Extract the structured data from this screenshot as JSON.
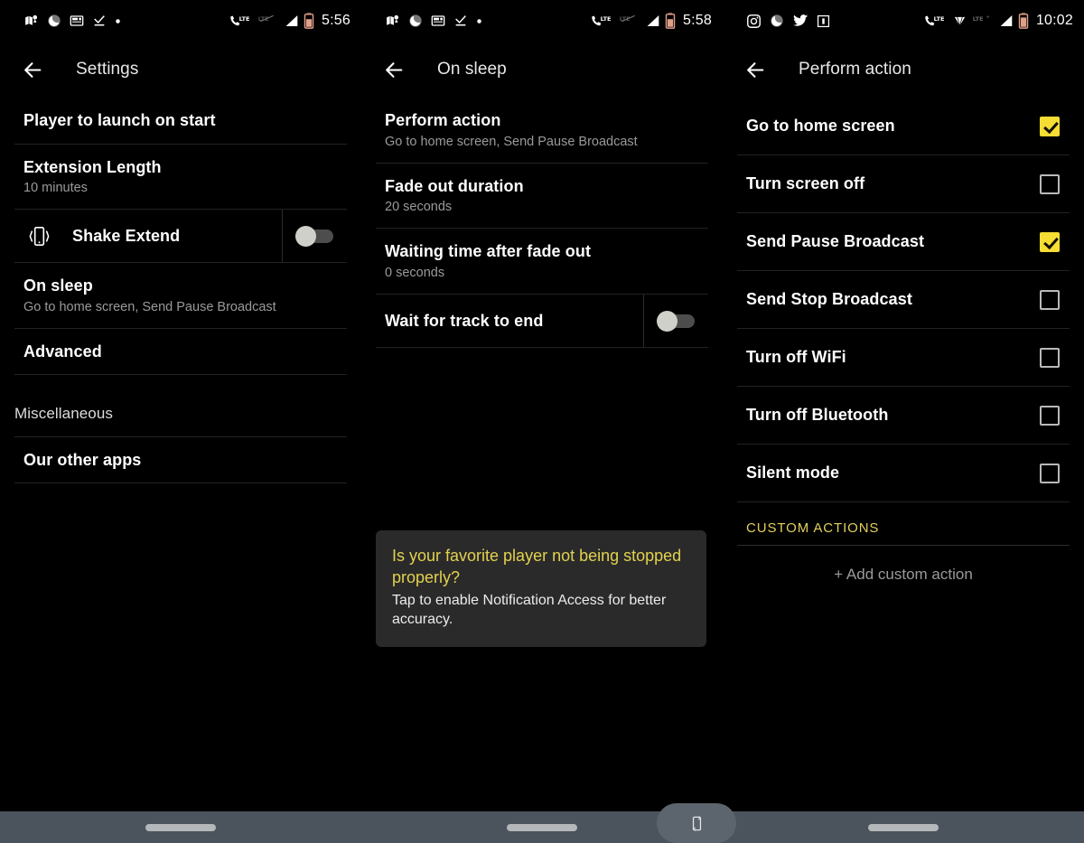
{
  "theme": {
    "background": "#000000",
    "accent_yellow": "#f5dd34",
    "snackbar_bg": "#2a2a2a",
    "navbar_bg": "#4b545c",
    "divider": "#222222"
  },
  "screens": [
    {
      "id": "settings",
      "statusbar": {
        "left_icons": [
          "map-location-icon",
          "do-not-disturb-moon-icon",
          "news-card-icon",
          "check-download-icon",
          "dot-icon"
        ],
        "right_icons": [
          "phone-lte-icon",
          "lte-secondary-icon",
          "signal-bars-icon",
          "battery-icon"
        ],
        "clock": "5:56"
      },
      "appbar": {
        "back": "back-arrow-icon",
        "title": "Settings"
      },
      "rows": [
        {
          "type": "simple",
          "title": "Player to launch on start",
          "subtitle": ""
        },
        {
          "type": "simple",
          "title": "Extension Length",
          "subtitle": "10 minutes"
        },
        {
          "type": "toggle",
          "icon": "vibrating-phone-icon",
          "title": "Shake Extend",
          "subtitle": "",
          "toggle_on": false
        },
        {
          "type": "simple",
          "title": "On sleep",
          "subtitle": "Go to home screen, Send Pause Broadcast"
        },
        {
          "type": "simple",
          "title": "Advanced",
          "subtitle": ""
        },
        {
          "type": "spacer"
        },
        {
          "type": "section",
          "title": "Miscellaneous",
          "subtitle": ""
        },
        {
          "type": "simple",
          "title": "Our other apps",
          "subtitle": ""
        }
      ],
      "snackbar": null
    },
    {
      "id": "on-sleep",
      "statusbar": {
        "left_icons": [
          "map-location-icon",
          "do-not-disturb-moon-icon",
          "news-card-icon",
          "check-download-icon",
          "dot-icon"
        ],
        "right_icons": [
          "phone-lte-icon",
          "lte-secondary-icon",
          "signal-bars-icon",
          "battery-icon"
        ],
        "clock": "5:58"
      },
      "appbar": {
        "back": "back-arrow-icon",
        "title": "On sleep"
      },
      "rows": [
        {
          "type": "simple",
          "title": "Perform action",
          "subtitle": "Go to home screen, Send Pause Broadcast"
        },
        {
          "type": "simple",
          "title": "Fade out duration",
          "subtitle": "20 seconds"
        },
        {
          "type": "simple",
          "title": "Waiting time after fade out",
          "subtitle": "0 seconds"
        },
        {
          "type": "toggle",
          "icon": "",
          "title": "Wait for track to end",
          "subtitle": "",
          "toggle_on": false
        }
      ],
      "snackbar": {
        "title": "Is your favorite player not being stopped properly?",
        "subtitle": "Tap to enable Notification Access for better accuracy."
      }
    },
    {
      "id": "perform-action",
      "statusbar": {
        "left_icons": [
          "instagram-icon",
          "do-not-disturb-moon-icon",
          "twitter-icon",
          "screenshot-icon"
        ],
        "right_icons": [
          "phone-lte-icon",
          "diamond-icon",
          "lte-secondary-icon",
          "signal-bars-icon",
          "battery-icon"
        ],
        "clock": "10:02"
      },
      "appbar": {
        "back": "back-arrow-icon",
        "title": "Perform action"
      },
      "rows": [
        {
          "type": "check",
          "title": "Go to home screen",
          "checked": true
        },
        {
          "type": "check",
          "title": "Turn screen off",
          "checked": false
        },
        {
          "type": "check",
          "title": "Send Pause Broadcast",
          "checked": true
        },
        {
          "type": "check",
          "title": "Send Stop Broadcast",
          "checked": false
        },
        {
          "type": "check",
          "title": "Turn off WiFi",
          "checked": false
        },
        {
          "type": "check",
          "title": "Turn off Bluetooth",
          "checked": false
        },
        {
          "type": "check",
          "title": "Silent mode",
          "checked": false
        }
      ],
      "category": {
        "label": "CUSTOM ACTIONS",
        "add_label": "+ Add custom action"
      },
      "snackbar": null
    }
  ],
  "navbar": {
    "pill_left": "home-pill-icon",
    "pill_middle": "home-pill-icon",
    "pill_right": "home-pill-icon",
    "rotate_button": "rotate-screen-icon"
  }
}
